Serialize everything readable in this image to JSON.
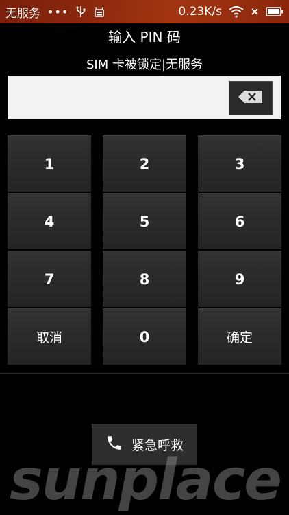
{
  "status_bar": {
    "carrier": "无服务",
    "dots": "•••",
    "usb_icon": "usb-icon",
    "debug_icon": "android-debug-icon",
    "net_speed": "0.23K/s",
    "wifi_icon": "wifi-icon",
    "signal_icon": "no-signal-icon",
    "battery_icon": "battery-icon"
  },
  "title": "输入 PIN 码",
  "subtitle": "SIM 卡被锁定|无服务",
  "pin": {
    "value": "",
    "placeholder": ""
  },
  "backspace_icon": "backspace-icon",
  "keypad": {
    "keys": [
      "1",
      "2",
      "3",
      "4",
      "5",
      "6",
      "7",
      "8",
      "9"
    ],
    "cancel": "取消",
    "zero": "0",
    "confirm": "确定"
  },
  "emergency": {
    "label": "紧急呼救",
    "icon": "phone-icon"
  },
  "watermark": "sunplace"
}
